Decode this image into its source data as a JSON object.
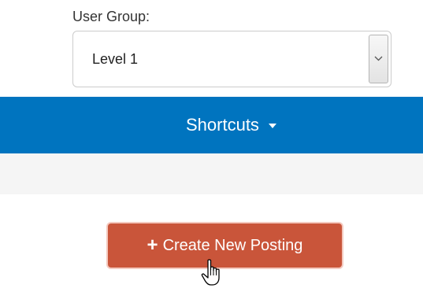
{
  "user_group": {
    "label": "User Group:",
    "selected_value": "Level 1"
  },
  "nav": {
    "shortcuts_label": "Shortcuts"
  },
  "actions": {
    "create_label": "Create New Posting",
    "create_icon": "plus-icon"
  },
  "colors": {
    "nav_bg": "#0074bf",
    "button_bg": "#c9553a",
    "strip_bg": "#f5f5f5"
  }
}
